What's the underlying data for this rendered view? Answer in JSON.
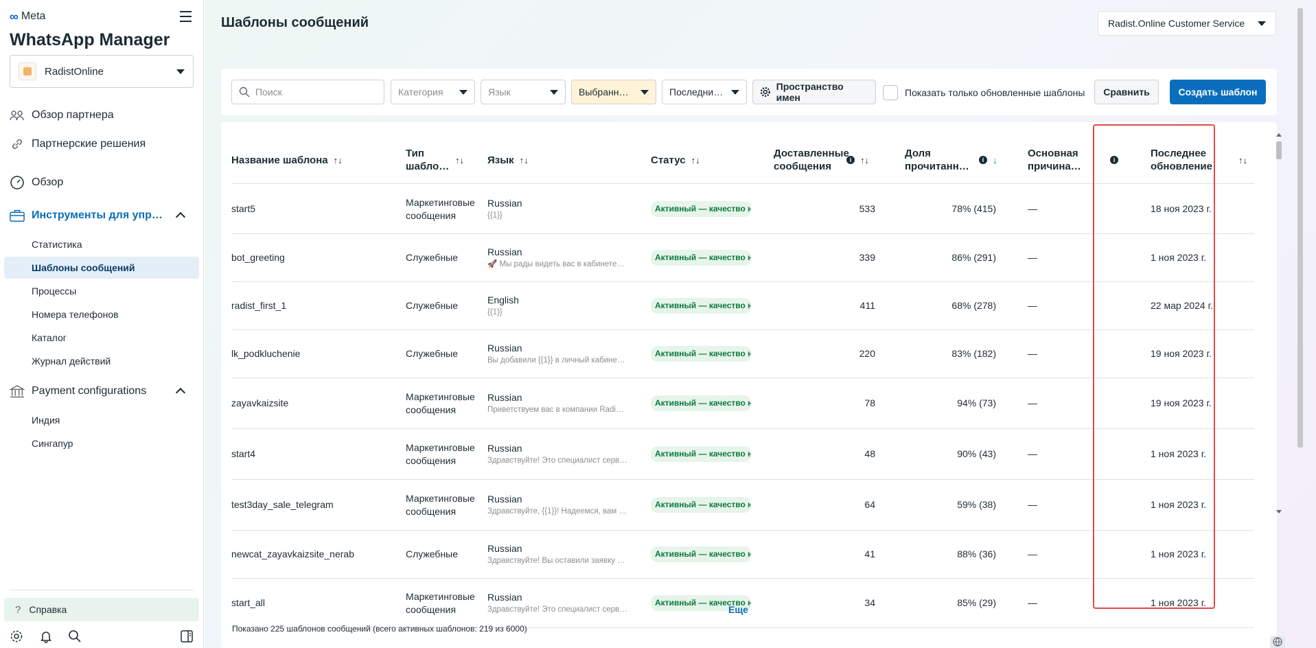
{
  "brand": {
    "meta_label": "Meta",
    "app_title": "WhatsApp Manager"
  },
  "account": {
    "name": "RadistOnline"
  },
  "nav": {
    "partner_overview": "Обзор партнера",
    "partner_solutions": "Партнерские решения",
    "overview": "Обзор",
    "tools": "Инструменты для упр…",
    "tools_items": [
      "Статистика",
      "Шаблоны сообщений",
      "Процессы",
      "Номера телефонов",
      "Каталог",
      "Журнал действий"
    ],
    "payment": "Payment configurations",
    "payment_items": [
      "Индия",
      "Сингапур"
    ],
    "help": "Справка"
  },
  "header": {
    "page_title": "Шаблоны сообщений",
    "business": "Radist.Online Customer Service"
  },
  "filters": {
    "search_placeholder": "Поиск",
    "category": "Категория",
    "language": "Язык",
    "selected": "Выбранн…",
    "recent": "Последни…",
    "namespace": "Пространство имен",
    "show_updated": "Показать только обновленные шаблоны",
    "compare": "Сравнить",
    "create": "Создать шаблон"
  },
  "table": {
    "headers": {
      "name": "Название шаблона",
      "type": "Тип шабло…",
      "language": "Язык",
      "status": "Статус",
      "delivered": "Доставленные сообщения",
      "read_rate": "Доля прочитанн…",
      "reason": "Основная причина…",
      "updated": "Последнее обновление"
    },
    "rows": [
      {
        "name": "start5",
        "type": "Маркетинговые сообщения",
        "lang": "Russian",
        "preview": "{{1}}",
        "status": "Активный — качество не определено",
        "delivered": "533",
        "read": "78% (415)",
        "reason": "—",
        "updated": "18 ноя 2023 г."
      },
      {
        "name": "bot_greeting",
        "type": "Служебные",
        "lang": "Russian",
        "preview": "🚀 Мы рады видеть вас в кабинете…",
        "status": "Активный — качество не определено",
        "delivered": "339",
        "read": "86% (291)",
        "reason": "—",
        "updated": "1 ноя 2023 г."
      },
      {
        "name": "radist_first_1",
        "type": "Служебные",
        "lang": "English",
        "preview": " {{1}}",
        "status": "Активный — качество не определено",
        "delivered": "411",
        "read": "68% (278)",
        "reason": "—",
        "updated": "22 мар 2024 г."
      },
      {
        "name": "lk_podkluchenie",
        "type": "Служебные",
        "lang": "Russian",
        "preview": "Вы добавили {{1}} в личный кабине…",
        "status": "Активный — качество не определено",
        "delivered": "220",
        "read": "83% (182)",
        "reason": "—",
        "updated": "19 ноя 2023 г."
      },
      {
        "name": "zayavkaizsite",
        "type": "Маркетинговые сообщения",
        "lang": "Russian",
        "preview": "Приветствуем вас в компании Radi…",
        "status": "Активный — качество не определено",
        "delivered": "78",
        "read": "94% (73)",
        "reason": "—",
        "updated": "19 ноя 2023 г."
      },
      {
        "name": "start4",
        "type": "Маркетинговые сообщения",
        "lang": "Russian",
        "preview": "Здравствуйте! Это специалист серв…",
        "status": "Активный — качество не определено",
        "delivered": "48",
        "read": "90% (43)",
        "reason": "—",
        "updated": "1 ноя 2023 г."
      },
      {
        "name": "test3day_sale_telegram",
        "type": "Маркетинговые сообщения",
        "lang": "Russian",
        "preview": "Здравствуйте, {{1}}! Надеемся, вам …",
        "status": "Активный — качество не определено",
        "delivered": "64",
        "read": "59% (38)",
        "reason": "—",
        "updated": "1 ноя 2023 г."
      },
      {
        "name": "newcat_zayavkaizsite_nerab",
        "type": "Служебные",
        "lang": "Russian",
        "preview": "Здравствуйте! Вы оставили заявку …",
        "status": "Активный — качество не определено",
        "delivered": "41",
        "read": "88% (36)",
        "reason": "—",
        "updated": "1 ноя 2023 г."
      },
      {
        "name": "start_all",
        "type": "Маркетинговые сообщения",
        "lang": "Russian",
        "preview": "Здравствуйте! Это специалист серв…",
        "status": "Активный — качество не определено",
        "delivered": "34",
        "read": "85% (29)",
        "reason": "—",
        "updated": "1 ноя 2023 г."
      }
    ],
    "more": "Еще",
    "footer": "Показано 225 шаблонов сообщений (всего активных шаблонов: 219 из 6000)"
  },
  "colors": {
    "accent": "#0a6ebd",
    "highlight": "#e04848",
    "status_bg": "#e6f4ea",
    "status_text": "#0b7a3e"
  }
}
